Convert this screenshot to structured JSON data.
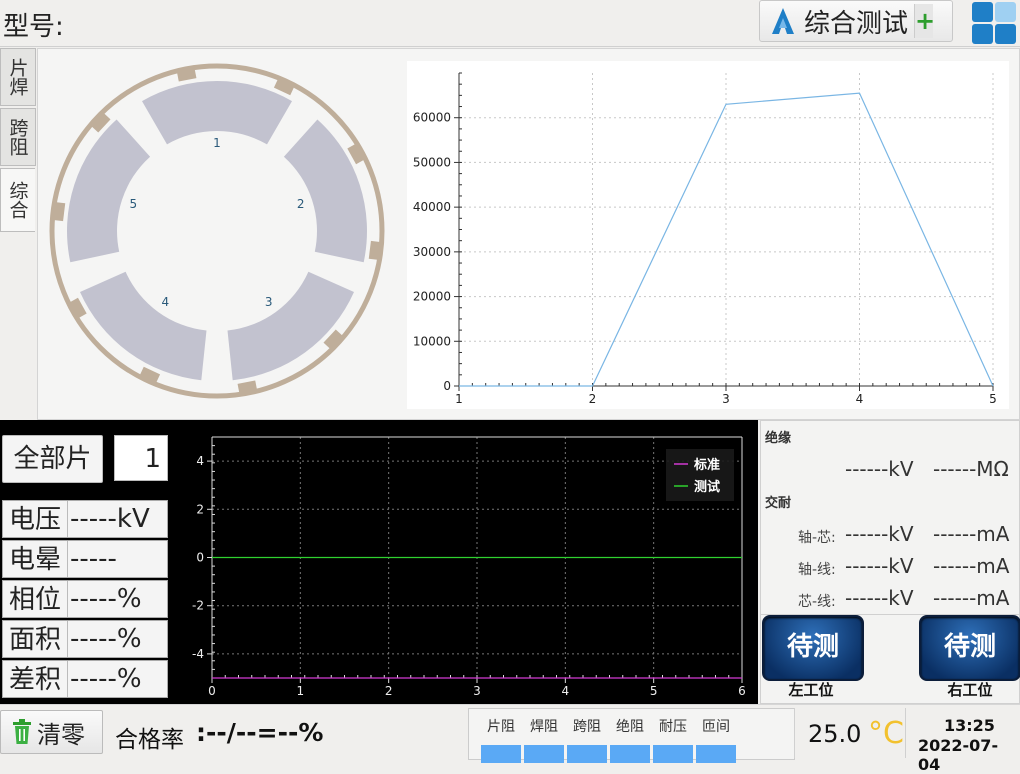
{
  "header": {
    "model_label": "型号:",
    "mode_button_label": "综合测试",
    "plus_label": "+"
  },
  "side_tabs": [
    "片焊",
    "跨阻",
    "综合"
  ],
  "motor": {
    "segments": [
      "1",
      "2",
      "3",
      "4",
      "5"
    ]
  },
  "chart_data": [
    {
      "type": "line",
      "x": [
        1,
        2,
        3,
        4,
        5
      ],
      "series": [
        {
          "values": [
            0,
            0,
            63000,
            65500,
            0
          ],
          "color": "#7ab6e4"
        }
      ],
      "xticks": [
        "1",
        "2",
        "3",
        "4",
        "5"
      ],
      "yticks": [
        "0",
        "10000",
        "20000",
        "30000",
        "40000",
        "50000",
        "60000"
      ],
      "xlim": [
        1,
        5
      ],
      "ylim": [
        0,
        70000
      ],
      "grid": true,
      "background": "#ffffff"
    },
    {
      "type": "line",
      "x": [
        0,
        6
      ],
      "series": [
        {
          "name": "标准",
          "values": [
            -5,
            -5
          ],
          "color": "#d23ad2"
        },
        {
          "name": "测试",
          "values": [
            0,
            0
          ],
          "color": "#2fd12f"
        }
      ],
      "xticks": [
        "0",
        "1",
        "2",
        "3",
        "4",
        "5",
        "6"
      ],
      "yticks": [
        "-4",
        "-2",
        "0",
        "2",
        "4"
      ],
      "xlim": [
        0,
        6
      ],
      "ylim": [
        -5,
        5
      ],
      "grid": true,
      "legend": "top-right",
      "background": "#000000"
    }
  ],
  "controls": {
    "all_pieces_label": "全部片",
    "piece_count": "1"
  },
  "params": [
    {
      "label": "电压",
      "value": "-----kV"
    },
    {
      "label": "电晕",
      "value": "-----"
    },
    {
      "label": "相位",
      "value": "-----%"
    },
    {
      "label": "面积",
      "value": "-----%"
    },
    {
      "label": "差积",
      "value": "-----%"
    }
  ],
  "insulation": {
    "title": "绝缘",
    "kv": "------kV",
    "mohm": "------MΩ"
  },
  "ac_withstand": {
    "title": "交耐",
    "rows": [
      {
        "label": "轴-芯:",
        "kv": "------kV",
        "ma": "------mA"
      },
      {
        "label": "轴-线:",
        "kv": "------kV",
        "ma": "------mA"
      },
      {
        "label": "芯-线:",
        "kv": "------kV",
        "ma": "------mA"
      }
    ]
  },
  "stations": {
    "left_status": "待测",
    "left_label": "左工位",
    "right_status": "待测",
    "right_label": "右工位"
  },
  "footer": {
    "clear_label": "清零",
    "pass_rate_label": "合格率",
    "pass_rate_value": ":--/--=--%",
    "status_items": [
      "片阻",
      "焊阻",
      "跨阻",
      "绝阻",
      "耐压",
      "匝间"
    ],
    "temperature": "25.0",
    "temp_unit": "°C",
    "time": "13:25",
    "date": "2022-07-04"
  },
  "colors": {
    "accent_blue": "#1f7fc7",
    "status_bar": "#5aa9f5",
    "segment_fill": "#c2c2cf",
    "ring": "#bfae9a"
  }
}
